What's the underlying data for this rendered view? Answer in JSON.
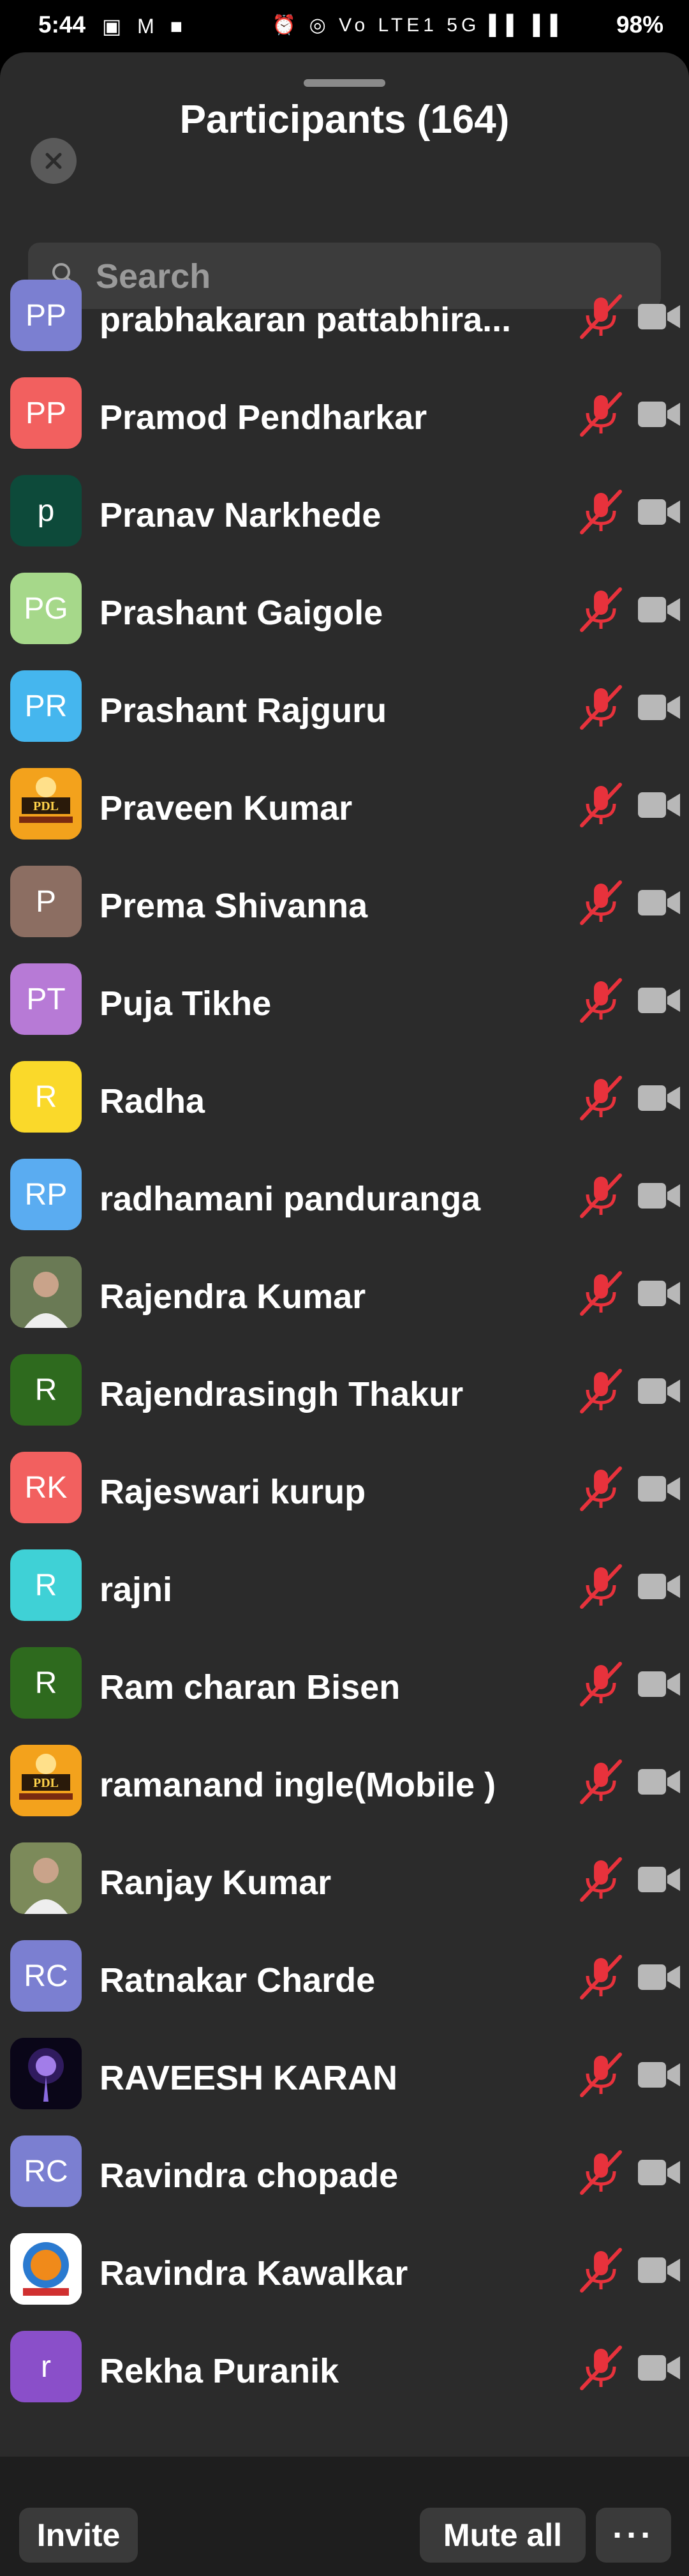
{
  "status_bar": {
    "time": "5:44",
    "left_icons": "▣ M ■",
    "right_icons": "⏰ ◎ Vo LTE1 5G ▌▌ ▌▌",
    "battery": "98%"
  },
  "header": {
    "title": "Participants (164)"
  },
  "search": {
    "placeholder": "Search"
  },
  "colors": {
    "sheet_bg": "#2b2b2b",
    "muted_mic": "#e8323c",
    "camera_icon": "#b8b8b8"
  },
  "participants": [
    {
      "name": "prabhakaran pattabhira...",
      "initials": "PP",
      "color": "#7b7fd1",
      "avatar_type": "initials"
    },
    {
      "name": "Pramod Pendharkar",
      "initials": "PP",
      "color": "#f2605f",
      "avatar_type": "initials"
    },
    {
      "name": "Pranav Narkhede",
      "initials": "p",
      "color": "#0d4a3a",
      "avatar_type": "initials"
    },
    {
      "name": "Prashant Gaigole",
      "initials": "PG",
      "color": "#a6d88a",
      "avatar_type": "initials"
    },
    {
      "name": "Prashant Rajguru",
      "initials": "PR",
      "color": "#45b6ee",
      "avatar_type": "initials"
    },
    {
      "name": "Praveen Kumar",
      "initials": "PDL",
      "color": "#f0a020",
      "avatar_type": "logo"
    },
    {
      "name": "Prema Shivanna",
      "initials": "P",
      "color": "#8c6e62",
      "avatar_type": "initials"
    },
    {
      "name": "Puja Tikhe",
      "initials": "PT",
      "color": "#b77ad6",
      "avatar_type": "initials"
    },
    {
      "name": "Radha",
      "initials": "R",
      "color": "#fad92a",
      "avatar_type": "initials"
    },
    {
      "name": "radhamani panduranga",
      "initials": "RP",
      "color": "#5aacf1",
      "avatar_type": "initials"
    },
    {
      "name": "Rajendra Kumar",
      "initials": "",
      "color": "#6a7a55",
      "avatar_type": "photo"
    },
    {
      "name": "Rajendrasingh Thakur",
      "initials": "R",
      "color": "#2e6a1e",
      "avatar_type": "initials"
    },
    {
      "name": "Rajeswari kurup",
      "initials": "RK",
      "color": "#f2605f",
      "avatar_type": "initials"
    },
    {
      "name": "rajni",
      "initials": "R",
      "color": "#3fd1d6",
      "avatar_type": "initials"
    },
    {
      "name": "Ram charan Bisen",
      "initials": "R",
      "color": "#2e6a1e",
      "avatar_type": "initials"
    },
    {
      "name": "ramanand ingle(Mobile )",
      "initials": "PDL",
      "color": "#f0a020",
      "avatar_type": "logo"
    },
    {
      "name": "Ranjay Kumar",
      "initials": "",
      "color": "#7c8a5a",
      "avatar_type": "photo"
    },
    {
      "name": "Ratnakar Charde",
      "initials": "RC",
      "color": "#7b7fd1",
      "avatar_type": "initials"
    },
    {
      "name": "RAVEESH KARAN",
      "initials": "",
      "color": "#150a2a",
      "avatar_type": "glow"
    },
    {
      "name": "Ravindra chopade",
      "initials": "RC",
      "color": "#7b7fd1",
      "avatar_type": "initials"
    },
    {
      "name": "Ravindra Kawalkar",
      "initials": "",
      "color": "#ffffff",
      "avatar_type": "emblem"
    },
    {
      "name": "Rekha Puranik",
      "initials": "r",
      "color": "#8a4fc9",
      "avatar_type": "initials"
    }
  ],
  "bottom_bar": {
    "invite_label": "Invite",
    "mute_all_label": "Mute all",
    "more_label": "···"
  }
}
